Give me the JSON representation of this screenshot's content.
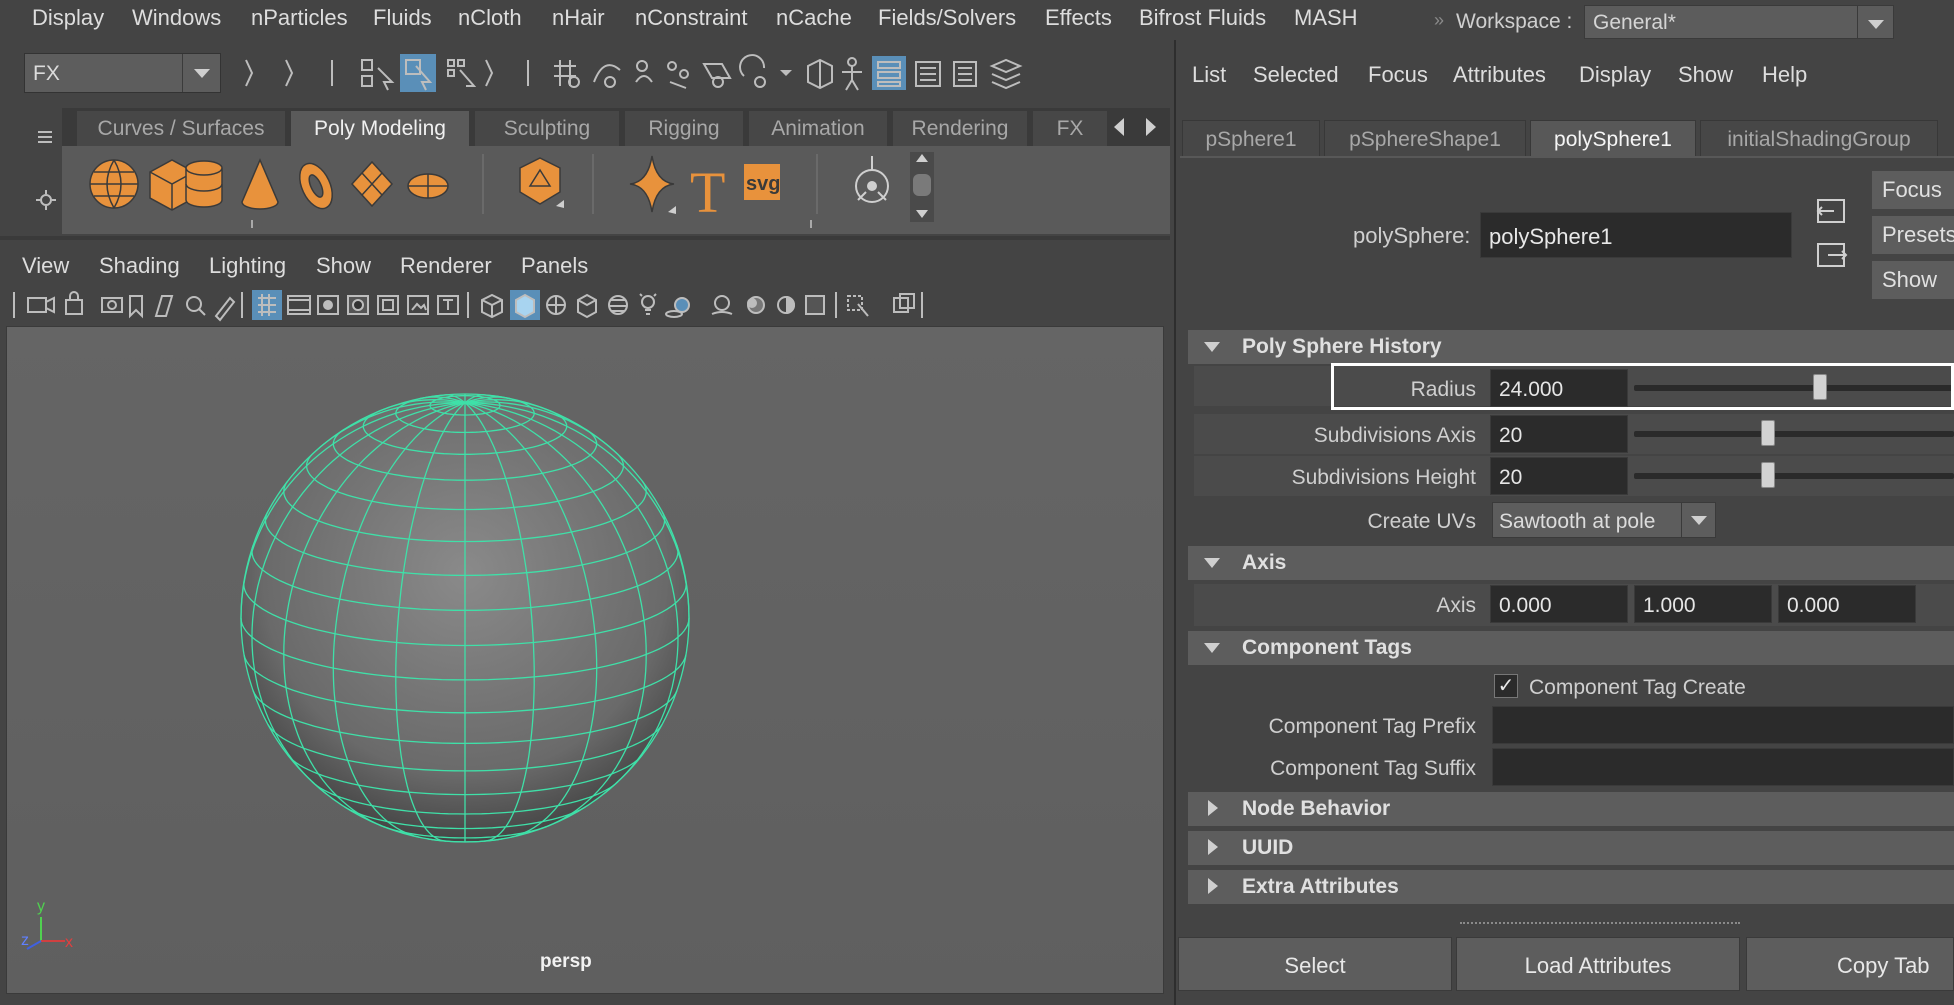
{
  "menubar": {
    "items": [
      "Display",
      "Windows",
      "nParticles",
      "Fluids",
      "nCloth",
      "nHair",
      "nConstraint",
      "nCache",
      "Fields/Solvers",
      "Effects",
      "Bifrost Fluids",
      "MASH"
    ],
    "workspace_label": "Workspace :",
    "workspace_value": "General*",
    "workspace_arrows": "»"
  },
  "statusline": {
    "menuset": "FX"
  },
  "shelf": {
    "tabs": [
      "Curves / Surfaces",
      "Poly Modeling",
      "Sculpting",
      "Rigging",
      "Animation",
      "Rendering",
      "FX"
    ],
    "active_tab": "Poly Modeling",
    "icons": [
      "poly-sphere-icon",
      "poly-cube-icon",
      "poly-cylinder-icon",
      "poly-cone-icon",
      "poly-torus-icon",
      "poly-plane-icon",
      "poly-disc-icon",
      "platonic-solid-icon",
      "sweep-mesh-icon",
      "type-tool-icon",
      "svg-tool-icon",
      "super-shape-icon"
    ],
    "svg_label": "svg",
    "type_label": "T"
  },
  "viewport": {
    "panel_menu": [
      "View",
      "Shading",
      "Lighting",
      "Show",
      "Renderer",
      "Panels"
    ],
    "camera_label": "persp",
    "axis_y": "y",
    "axis_z": "z",
    "axis_x": "x"
  },
  "attribute_editor": {
    "menu": [
      "List",
      "Selected",
      "Focus",
      "Attributes",
      "Display",
      "Show",
      "Help"
    ],
    "tabs": [
      "pSphere1",
      "pSphereShape1",
      "polySphere1",
      "initialShadingGroup"
    ],
    "active_tab": "polySphere1",
    "node_label": "polySphere:",
    "node_value": "polySphere1",
    "side_buttons": [
      "Focus",
      "Presets",
      "Show"
    ],
    "sections": {
      "history": "Poly Sphere History",
      "axis": "Axis",
      "component_tags": "Component Tags",
      "node_behavior": "Node Behavior",
      "uuid": "UUID",
      "extra": "Extra Attributes"
    },
    "radius": {
      "label": "Radius",
      "value": "24.000",
      "slider_level": 0.58
    },
    "subdivisions_axis": {
      "label": "Subdivisions Axis",
      "value": "20",
      "slider_level": 0.42
    },
    "subdivisions_height": {
      "label": "Subdivisions Height",
      "value": "20",
      "slider_level": 0.42
    },
    "create_uvs": {
      "label": "Create UVs",
      "value": "Sawtooth at pole"
    },
    "axis": {
      "label": "Axis",
      "x": "0.000",
      "y": "1.000",
      "z": "0.000"
    },
    "component_tag_create": {
      "label": "Component Tag Create",
      "checked": "✓"
    },
    "component_tag_prefix": {
      "label": "Component Tag Prefix",
      "value": ""
    },
    "component_tag_suffix": {
      "label": "Component Tag Suffix",
      "value": ""
    },
    "buttons": [
      "Select",
      "Load Attributes",
      "Copy Tab"
    ]
  },
  "colors": {
    "wireframe": "#3fe0a8",
    "shelf_icon": "#e8923c",
    "highlight": "#5a8fb8"
  }
}
